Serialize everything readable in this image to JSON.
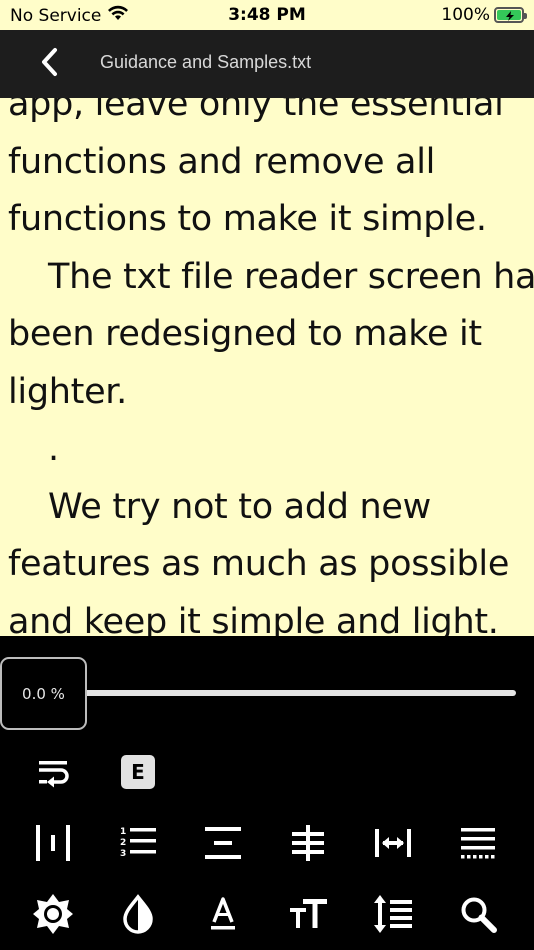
{
  "status_bar": {
    "carrier": "No Service",
    "time": "3:48 PM",
    "battery": "100%",
    "battery_level": 1.0,
    "battery_color": "#34c759"
  },
  "nav": {
    "back_icon": "chevron-left-icon",
    "title": "Guidance and Samples.txt"
  },
  "reader": {
    "background": "#fffdc9",
    "lines": [
      "app, leave only the essential",
      "functions and remove all",
      "functions to make it simple.",
      "The txt file reader screen has",
      "been redesigned to make it",
      "lighter.",
      ".",
      "We try not to add new",
      "features as much as possible",
      "and keep it simple and light."
    ]
  },
  "progress": {
    "label": "0.0 %",
    "value": 0.0
  },
  "toolbar": {
    "row1": [
      {
        "name": "word-wrap-icon"
      },
      {
        "name": "encoding-e-icon",
        "label": "E"
      }
    ],
    "row2": [
      {
        "name": "margin-icon"
      },
      {
        "name": "line-numbers-icon"
      },
      {
        "name": "align-center-icon"
      },
      {
        "name": "strikethrough-icon"
      },
      {
        "name": "width-icon"
      },
      {
        "name": "paragraph-spacing-icon"
      }
    ],
    "row3": [
      {
        "name": "brightness-icon"
      },
      {
        "name": "contrast-icon"
      },
      {
        "name": "font-color-icon"
      },
      {
        "name": "font-size-icon"
      },
      {
        "name": "line-spacing-icon"
      },
      {
        "name": "search-icon"
      }
    ]
  }
}
